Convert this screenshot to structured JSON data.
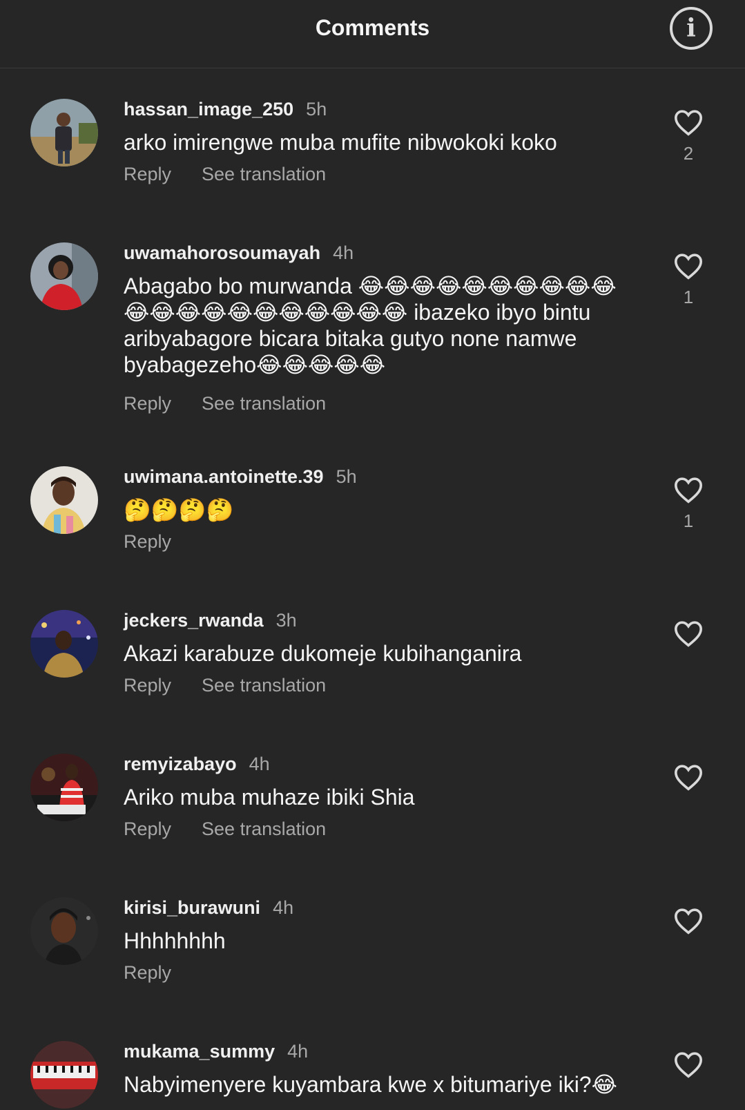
{
  "header": {
    "title": "Comments",
    "info_icon": "info-icon",
    "info_glyph": "i"
  },
  "actions": {
    "reply": "Reply",
    "see_translation": "See translation"
  },
  "comments": [
    {
      "username": "hassan_image_250",
      "time": "5h",
      "text": "arko imirengwe muba mufite nibwokoki koko",
      "likes": "2"
    },
    {
      "username": "uwamahorosoumayah",
      "time": "4h",
      "text": "Abagabo bo murwanda 😂😂😂😂😂😂😂😂😂😂😂😂😂😂😂😂😂😂😂😂😂 ibazeko ibyo bintu aribyabagore bicara bitaka gutyo none namwe byabagezeho😂😂😂😂😂",
      "likes": "1"
    },
    {
      "username": "uwimana.antoinette.39",
      "time": "5h",
      "text": "🤔🤔🤔🤔",
      "likes": "1"
    },
    {
      "username": "jeckers_rwanda",
      "time": "3h",
      "text": "Akazi karabuze dukomeje kubihanganira",
      "likes": ""
    },
    {
      "username": "remyizabayo",
      "time": "4h",
      "text": "Ariko muba muhaze ibiki Shia",
      "likes": ""
    },
    {
      "username": "kirisi_burawuni",
      "time": "4h",
      "text": "Hhhhhhhh",
      "likes": ""
    },
    {
      "username": "mukama_summy",
      "time": "4h",
      "text": "Nabyimenyere kuyambara kwe x bitumariye iki?😂",
      "likes": ""
    }
  ],
  "colors": {
    "background": "#262626",
    "text_primary": "#f5f5f5",
    "text_secondary": "#a8a8a8"
  }
}
